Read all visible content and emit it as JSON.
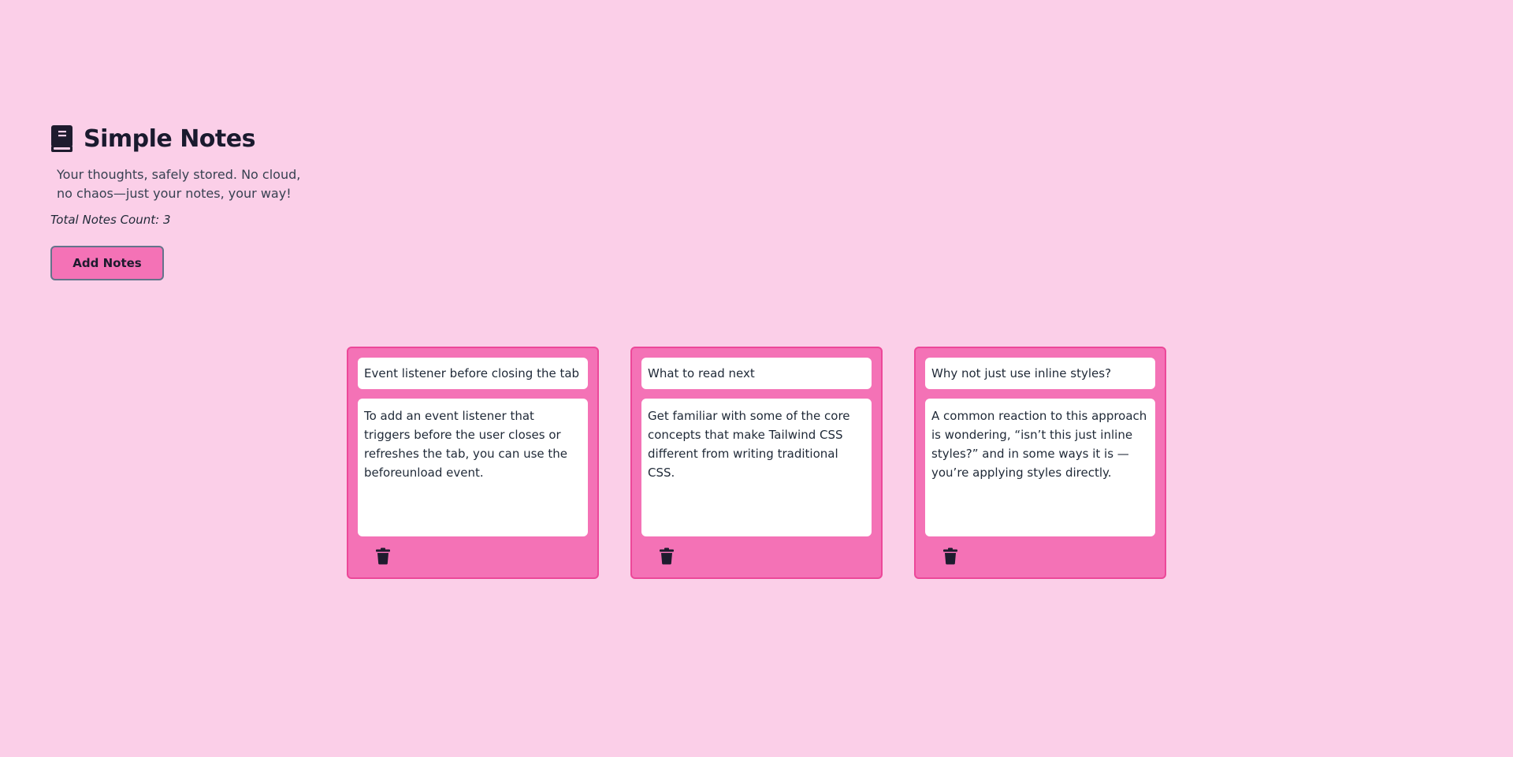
{
  "app": {
    "title": "Simple Notes",
    "subtitle": "Your thoughts, safely stored. No cloud, no chaos—just your notes, your way!",
    "count_text": "Total Notes Count: 3",
    "add_label": "Add Notes",
    "icon": "book-icon"
  },
  "notes": [
    {
      "title": "Event listener before closing the tab",
      "body": "To add an event listener that triggers before the user closes or refreshes the tab, you can use the beforeunload event."
    },
    {
      "title": "What to read next",
      "body": "Get familiar with some of the core concepts that make Tailwind CSS different from writing traditional CSS."
    },
    {
      "title": "Why not just use inline styles?",
      "body": "A common reaction to this approach is wondering, “isn’t this just inline styles?” and in some ways it is — you’re applying styles directly."
    }
  ],
  "icons": {
    "delete": "trash-icon"
  },
  "colors": {
    "background": "#fbcfe8",
    "accent": "#f472b6",
    "card_border": "#ec4899",
    "text": "#1e1b2e"
  }
}
